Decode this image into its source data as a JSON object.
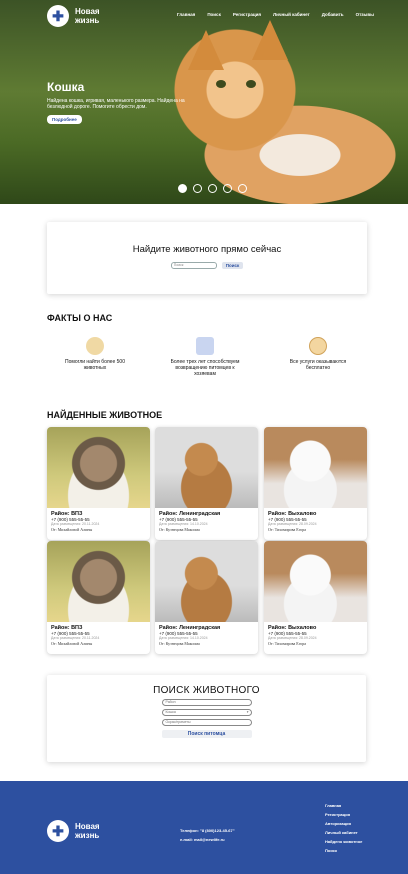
{
  "brand": {
    "name": "Новая жизнь"
  },
  "nav": [
    "Главная",
    "Поиск",
    "Регистрация",
    "Личный кабинет",
    "Добавить",
    "Отзывы"
  ],
  "hero": {
    "title": "Кошка",
    "text": "Найдена кошка, игривая, маленького размера. Найдена на безлюдной дороге. Помогите обрести дом.",
    "button": "Подробнее",
    "slides": 5,
    "active_slide": 1
  },
  "quick_search": {
    "title": "Найдите животного прямо сейчас",
    "placeholder": "Поиск",
    "button": "Поиск"
  },
  "facts": {
    "title": "ФАКТЫ О НАС",
    "items": [
      {
        "icon": "pets-icon",
        "text": "Помогли найти более 500 животных"
      },
      {
        "icon": "house-icon",
        "text": "Более трех лет способствуем возвращению питомцев к хозяевам"
      },
      {
        "icon": "free-badge-icon",
        "text": "Все услуги оказываются бесплатно"
      }
    ]
  },
  "found": {
    "title": "НАЙДЕННЫЕ ЖИВОТНОЕ",
    "cards": [
      {
        "img": "cat1",
        "district": "Район: ВПЗ",
        "phone": "+7 (900) 555-55-55",
        "date": "Дата размещения: 20.11.2024",
        "owner": "От: Михайловой Алины"
      },
      {
        "img": "cat2",
        "district": "Район: Ленинградская",
        "phone": "+7 (900) 555-55-55",
        "date": "Дата размещения: 14.10.2024",
        "owner": "От: Кузнецова Максима"
      },
      {
        "img": "dog",
        "district": "Район: Выхалово",
        "phone": "+7 (900) 555-55-55",
        "date": "Дата размещения: 28.09.2024",
        "owner": "От: Тихомирова Егора"
      },
      {
        "img": "cat1",
        "district": "Район: ВПЗ",
        "phone": "+7 (900) 555-55-55",
        "date": "Дата размещения: 20.11.2024",
        "owner": "От: Михайловой Алины"
      },
      {
        "img": "cat2",
        "district": "Район: Ленинградская",
        "phone": "+7 (900) 555-55-55",
        "date": "Дата размещения: 14.10.2024",
        "owner": "От: Кузнецова Максима"
      },
      {
        "img": "dog",
        "district": "Район: Выхалово",
        "phone": "+7 (900) 555-55-55",
        "date": "Дата размещения: 28.09.2024",
        "owner": "От: Тихомирова Егора"
      }
    ]
  },
  "animal_search": {
    "title": "ПОИСК ЖИВОТНОГО",
    "field1": "Район",
    "field2": "Кошка",
    "field3": "Окрас/приметы",
    "button": "Поиск питомца"
  },
  "footer": {
    "phone": "Телефон: \"8 (800)123-45-67\"",
    "email": "e-mail: mail@newlife.ru",
    "links": [
      "Главная",
      "Регистрация",
      "Авторизация",
      "Личный кабинет",
      "Найдено животное",
      "Поиск"
    ]
  },
  "colors": {
    "brand": "#2d50a0"
  }
}
